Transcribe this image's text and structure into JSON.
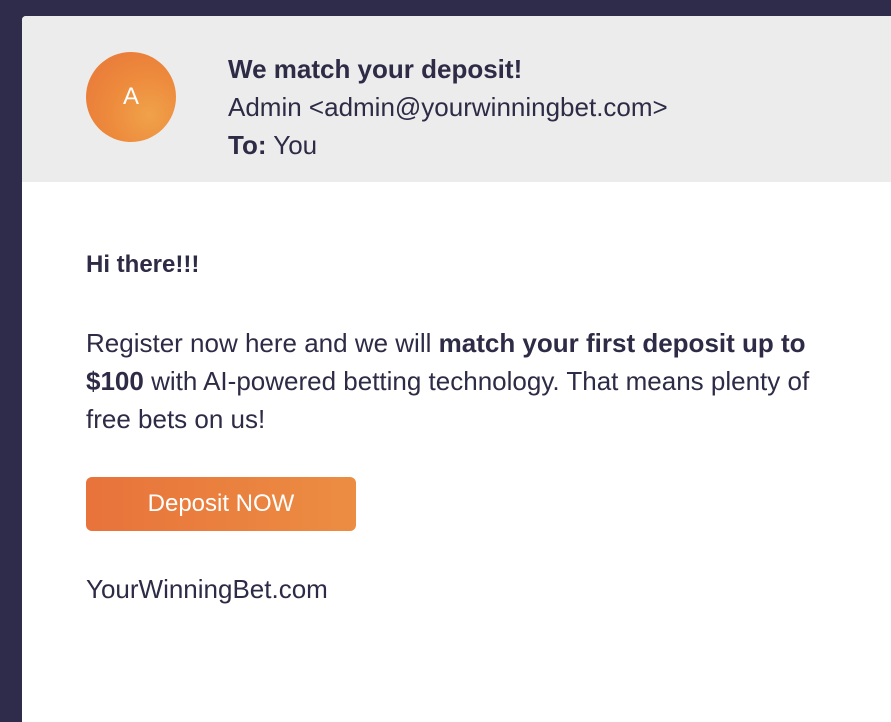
{
  "email": {
    "sender_initial": "A",
    "subject": "We match your deposit!",
    "from": "Admin <admin@yourwinningbet.com>",
    "to_label": "To:",
    "to_value": "You"
  },
  "content": {
    "greeting": "Hi there!!!",
    "message_part1": "Register now here and we will ",
    "message_bold": "match your first deposit up to $100",
    "message_part2": " with AI-powered betting technology. That means plenty of free bets on us!",
    "cta_label": "Deposit NOW",
    "signature": "YourWinningBet.com"
  },
  "colors": {
    "background": "#2e2c4a",
    "header_bg": "#ececec",
    "accent": "#e8733b",
    "text": "#2d2b45"
  }
}
